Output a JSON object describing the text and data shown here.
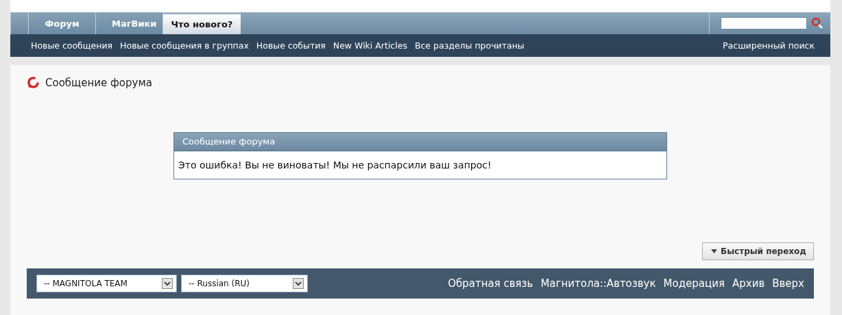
{
  "tabs": [
    {
      "label": "Форум",
      "selected": false
    },
    {
      "label": "МагВики",
      "selected": false
    },
    {
      "label": "Что нового?",
      "selected": true
    }
  ],
  "subnav": {
    "links": [
      "Новые сообщения",
      "Новые сообщения в группах",
      "Новые события",
      "New Wiki Articles",
      "Все разделы прочитаны"
    ],
    "advanced": "Расширенный поиск"
  },
  "page_title": "Сообщение форума",
  "message_box": {
    "title": "Сообщение форума",
    "text": "Это ошибка! Вы не виноваты! Мы не распарсили ваш запрос!"
  },
  "quick_nav": "Быстрый переход",
  "footer": {
    "selects": [
      "-- MAGNITOLA TEAM",
      "-- Russian (RU)"
    ],
    "links": [
      "Обратная связь",
      "Магнитола::Автозвук",
      "Модерация",
      "Архив",
      "Вверх"
    ]
  }
}
